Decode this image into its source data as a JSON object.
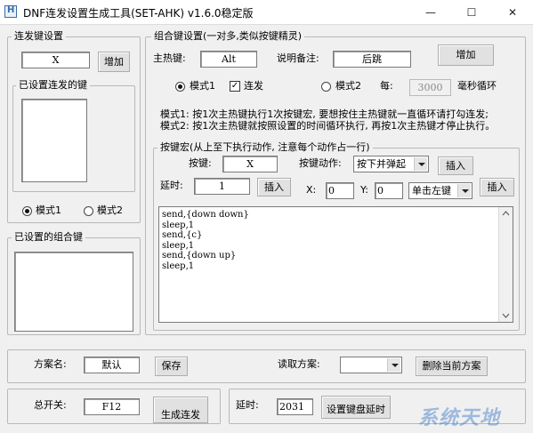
{
  "window": {
    "title": "DNF连发设置生成工具(SET-AHK) v1.6.0稳定版",
    "controls": {
      "minimize": "—",
      "maximize": "☐",
      "close": "✕"
    }
  },
  "combo_panel": {
    "group_label": "连发键设置",
    "key_value": "X",
    "add_label": "增加",
    "set_keys_label": "已设置连发的键",
    "mode1_label": "模式1",
    "mode2_label": "模式2",
    "mode1_selected": true
  },
  "combo_keys_panel": {
    "group_label": "已设置的组合键"
  },
  "combo_settings": {
    "group_label": "组合键设置(一对多,类似按键精灵)",
    "hotkey_label": "主热键:",
    "hotkey_value": "Alt",
    "note_label": "说明备注:",
    "note_value": "后跳",
    "add_label": "增加",
    "mode1_label": "模式1",
    "mode1_selected": true,
    "repeat_label": "连发",
    "repeat_checked": true,
    "repeat_check_glyph": "✓",
    "mode2_label": "模式2",
    "every_label": "每:",
    "every_value": "3000",
    "ms_label": "毫秒循环",
    "desc_line1": "模式1: 按1次主热键执行1次按键宏, 要想按住主热键就一直循环请打勾连发;",
    "desc_line2": "模式2: 按1次主热键就按照设置的时间循环执行, 再按1次主热键才停止执行。"
  },
  "macro": {
    "group_label": "按键宏(从上至下执行动作, 注意每个动作占一行)",
    "key_label": "按键:",
    "key_value": "X",
    "action_label": "按键动作:",
    "action_value": "按下并弹起",
    "insert_label": "插入",
    "delay_label": "延时:",
    "delay_value": "1",
    "delay_insert_label": "插入",
    "x_label": "X:",
    "x_value": "0",
    "y_label": "Y:",
    "y_value": "0",
    "click_value": "单击左键",
    "click_insert_label": "插入",
    "lines": [
      "send,{down down}",
      "sleep,1",
      "send,{c}",
      "sleep,1",
      "send,{down up}",
      "sleep,1"
    ]
  },
  "scheme": {
    "name_label": "方案名:",
    "name_value": "默认",
    "save_label": "保存",
    "read_label": "读取方案:",
    "read_value": "",
    "delete_label": "删除当前方案"
  },
  "bottom": {
    "master_label": "总开关:",
    "master_value": "F12",
    "generate_label": "生成连发",
    "delay_label": "延时:",
    "delay_value": "2031",
    "keyboard_delay_label": "设置键盘延时"
  },
  "watermark": "系统天地"
}
